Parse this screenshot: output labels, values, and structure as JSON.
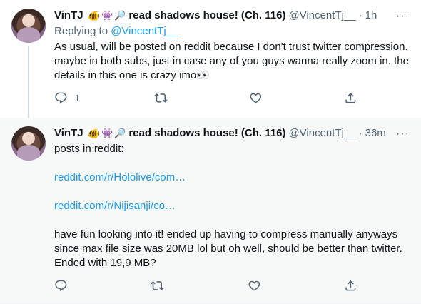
{
  "tweets": [
    {
      "name": "VinTJ",
      "emoji": [
        "🐠",
        "👾",
        "🔎"
      ],
      "title": "read shadows house! (Ch. 116)",
      "handle": "@VincentTj__",
      "time": "1h",
      "reply_prefix": "Replying to ",
      "reply_handle": "@VincentTj__",
      "text": "As usual, will be posted on reddit because I don't trust twitter compression. maybe in both subs, just in case any of you guys wanna really zoom in. the details in this one is crazy imo",
      "text_emoji": "👀",
      "actions": {
        "reply_count": "1",
        "retweet_count": "",
        "like_count": ""
      }
    },
    {
      "name": "VinTJ",
      "emoji": [
        "🐠",
        "👾",
        "🔎"
      ],
      "title": "read shadows house! (Ch. 116)",
      "handle": "@VincentTj__",
      "time": "36m",
      "intro": "posts in reddit:",
      "link1": "reddit.com/r/Hololive/com…",
      "link2": "reddit.com/r/Nijisanji/co…",
      "text": "have fun looking into it! ended up having to compress manually anyways since max file size was 20MB lol but oh well, should be better than twitter. Ended with 19,9 MB?",
      "actions": {
        "reply_count": "",
        "retweet_count": "",
        "like_count": ""
      }
    }
  ],
  "icons": {
    "more": "more-icon",
    "reply": "reply-icon",
    "retweet": "retweet-icon",
    "like": "like-icon",
    "share": "share-icon"
  },
  "colors": {
    "link": "#1d9bf0",
    "secondary_text": "#536471",
    "primary_text": "#0f1419",
    "highlight_bg": "#f7f9f9"
  }
}
